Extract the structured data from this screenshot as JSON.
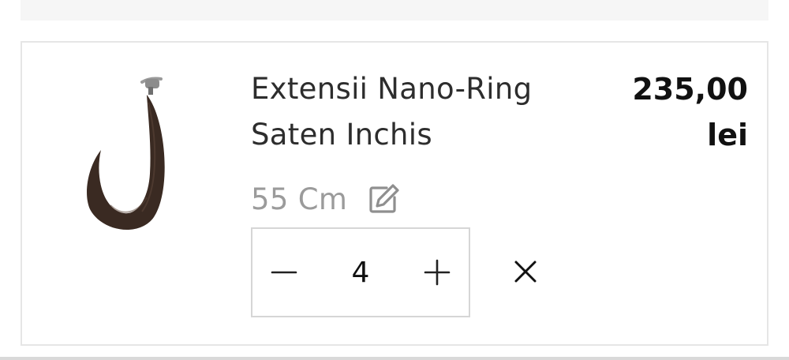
{
  "product": {
    "title_line1": "Extensii Nano-Ring",
    "title_line2": "Saten Inchis",
    "price_amount": "235,00",
    "price_currency": "lei",
    "variant": "55 Cm",
    "quantity": "4"
  },
  "icons": {
    "edit": "edit-icon",
    "minus": "minus-icon",
    "plus": "plus-icon",
    "remove": "close-icon"
  },
  "colors": {
    "title": "#2d2d2d",
    "variant": "#9b9b9b",
    "border": "#e6e6e6",
    "stepper_border": "#d6d6d6",
    "hair": "#3a2a22"
  }
}
